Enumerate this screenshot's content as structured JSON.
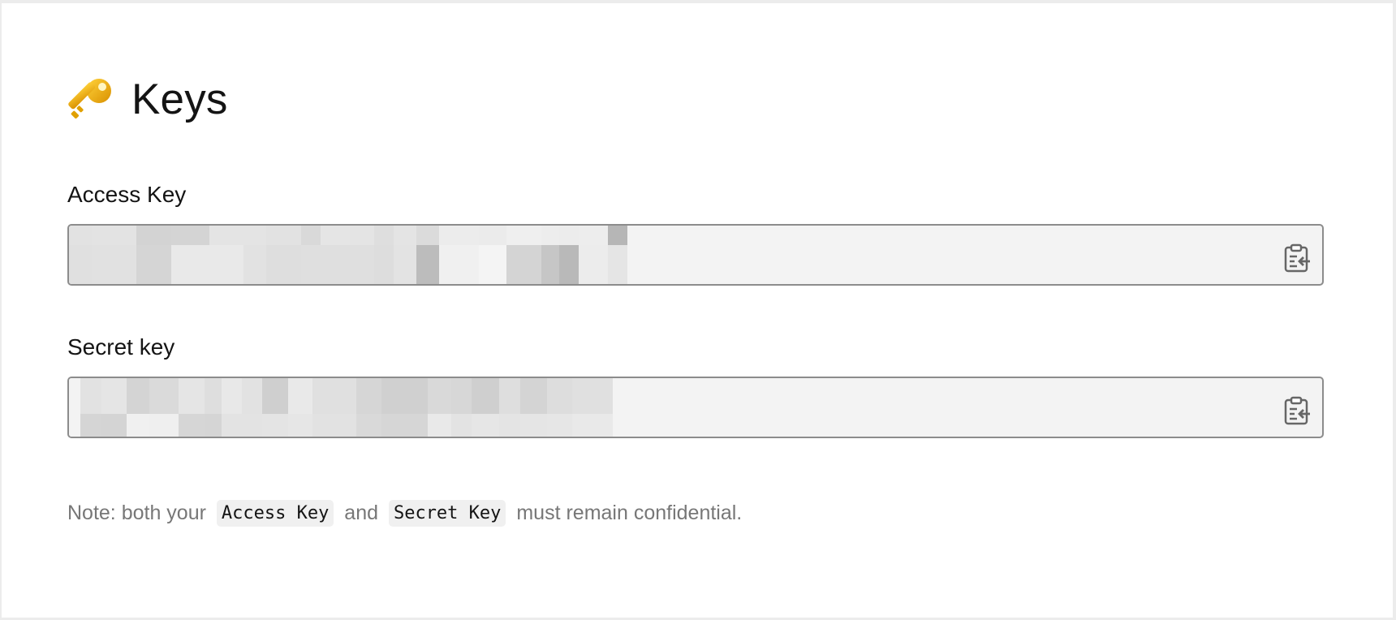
{
  "page": {
    "title": "Keys",
    "icon": "key-icon"
  },
  "access_key": {
    "label": "Access Key",
    "value_masked": true,
    "copy_icon": "clipboard-paste-icon"
  },
  "secret_key": {
    "label": "Secret key",
    "value_masked": true,
    "copy_icon": "clipboard-paste-icon"
  },
  "note": {
    "prefix": "Note: both your ",
    "code1": "Access Key",
    "middle": " and ",
    "code2": "Secret Key",
    "suffix": " must remain confidential."
  },
  "colors": {
    "background": "#ececec",
    "card": "#ffffff",
    "field_bg": "#f3f3f3",
    "field_border": "#8c8c8c",
    "note_text": "#777777",
    "key_icon": "#f2b705"
  }
}
